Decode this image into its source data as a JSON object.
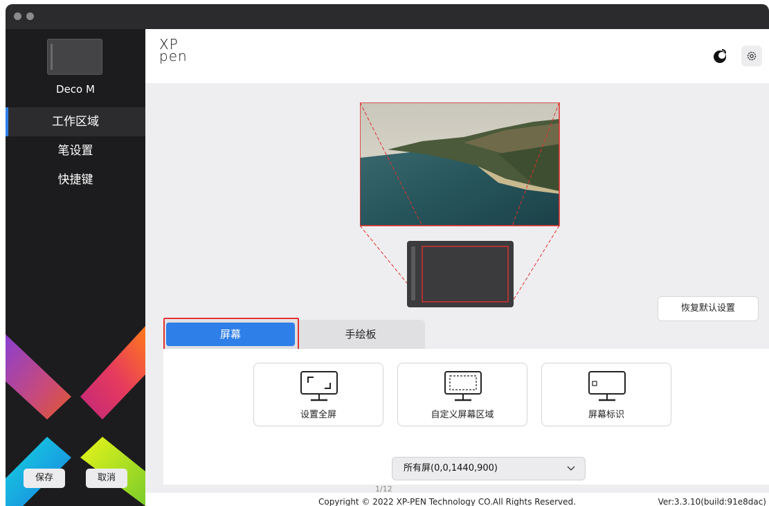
{
  "window": {
    "title": ""
  },
  "sidebar": {
    "device_name": "Deco M",
    "items": [
      {
        "label": "工作区域",
        "active": true
      },
      {
        "label": "笔设置",
        "active": false
      },
      {
        "label": "快捷键",
        "active": false
      }
    ],
    "save_label": "保存",
    "cancel_label": "取消"
  },
  "header": {
    "logo_line1": "XP",
    "logo_line2": "pen",
    "icons": [
      "theme-toggle-icon",
      "gear-icon"
    ]
  },
  "preview": {
    "restore_defaults_label": "恢复默认设置"
  },
  "tabs": [
    {
      "label": "屏幕",
      "active": true
    },
    {
      "label": "手绘板",
      "active": false
    }
  ],
  "modes": [
    {
      "label": "设置全屏",
      "icon": "fullscreen-monitor-icon"
    },
    {
      "label": "自定义屏幕区域",
      "icon": "custom-area-monitor-icon"
    },
    {
      "label": "屏幕标识",
      "icon": "screen-identify-monitor-icon"
    }
  ],
  "screen_select": {
    "value": "所有屏(0,0,1440,900)"
  },
  "footer": {
    "page_counter": "1/12",
    "copyright": "Copyright © 2022  XP-PEN Technology CO.All Rights Reserved.",
    "version": "Ver:3.3.10(build:91e8dac)"
  },
  "colors": {
    "accent": "#2f7fe8",
    "highlight_outline": "#e03030",
    "sidebar_bg": "#1c1c1e"
  }
}
